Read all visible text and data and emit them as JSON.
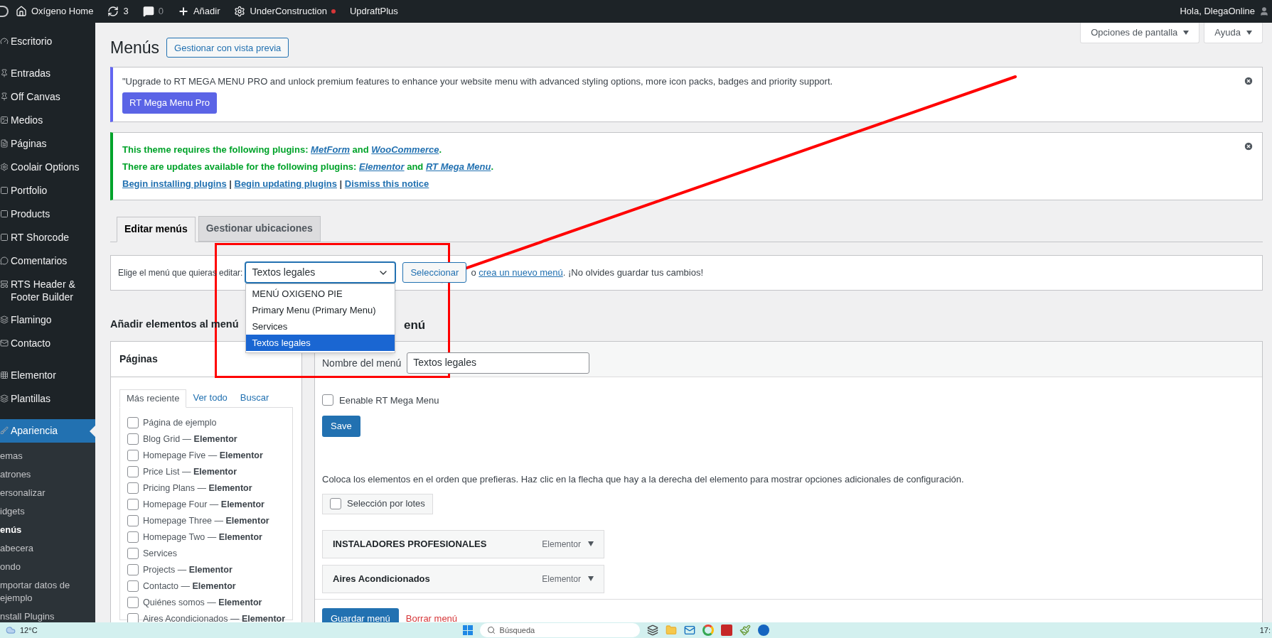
{
  "admin_bar": {
    "items": [
      {
        "kind": "home",
        "label": "Oxígeno Home"
      },
      {
        "kind": "updates",
        "label": "3"
      },
      {
        "kind": "comments",
        "label": "0"
      },
      {
        "kind": "new",
        "label": "Añadir"
      },
      {
        "kind": "construction",
        "label": "UnderConstruction"
      },
      {
        "kind": "plain",
        "label": "UpdraftPlus"
      }
    ],
    "greeting": "Hola, DlegaOnline"
  },
  "sidebar": {
    "items": [
      {
        "label": "Escritorio",
        "selected": false
      },
      {
        "label": "Entradas",
        "selected": false
      },
      {
        "label": "Off Canvas",
        "selected": false
      },
      {
        "label": "Medios",
        "selected": false
      },
      {
        "label": "Páginas",
        "selected": false
      },
      {
        "label": "Coolair Options",
        "selected": false
      },
      {
        "label": "Portfolio",
        "selected": false
      },
      {
        "label": "Products",
        "selected": false
      },
      {
        "label": "RT Shorcode",
        "selected": false
      },
      {
        "label": "Comentarios",
        "selected": false
      },
      {
        "label": "RTS Header & Footer Builder",
        "selected": false
      },
      {
        "label": "Flamingo",
        "selected": false
      },
      {
        "label": "Contacto",
        "selected": false
      },
      {
        "label": "Elementor",
        "selected": false
      },
      {
        "label": "Plantillas",
        "selected": false
      },
      {
        "label": "Apariencia",
        "selected": true
      }
    ],
    "submenu": [
      {
        "label": "emas",
        "selected": false
      },
      {
        "label": "atrones",
        "selected": false
      },
      {
        "label": "ersonalizar",
        "selected": false
      },
      {
        "label": "idgets",
        "selected": false
      },
      {
        "label": "enús",
        "selected": true
      },
      {
        "label": "abecera",
        "selected": false
      },
      {
        "label": "ondo",
        "selected": false
      },
      {
        "label": "mportar datos de ejemplo",
        "selected": false
      },
      {
        "label": "nstall Plugins",
        "selected": false
      }
    ]
  },
  "page": {
    "title": "Menús",
    "preview_button": "Gestionar con vista previa",
    "screen_options": "Opciones de pantalla",
    "help": "Ayuda"
  },
  "notices": [
    {
      "kind": "promo",
      "text": "\"Upgrade to RT MEGA MENU PRO and unlock premium features to enhance your website menu with advanced styling options, more icon packs, badges and priority support.",
      "button": "RT Mega Menu Pro"
    },
    {
      "kind": "plugins",
      "lines": [
        [
          {
            "text": "This theme requires the following plugins: "
          },
          {
            "link": "MetForm"
          },
          {
            "text": " and "
          },
          {
            "link": "WooCommerce"
          },
          {
            "text": "."
          }
        ],
        [
          {
            "text": "There are updates available for the following plugins: "
          },
          {
            "link": "Elementor"
          },
          {
            "text": " and "
          },
          {
            "link": "RT Mega Menu"
          },
          {
            "text": "."
          }
        ]
      ],
      "actions": [
        {
          "link": "Begin installing plugins"
        },
        {
          "text": " | "
        },
        {
          "link": "Begin updating plugins"
        },
        {
          "text": " | "
        },
        {
          "link": "Dismiss this notice"
        }
      ]
    }
  ],
  "tabs": [
    {
      "label": "Editar menús",
      "selected": true
    },
    {
      "label": "Gestionar ubicaciones",
      "selected": false
    }
  ],
  "menu_picker": {
    "label": "Elige el menú que quieras editar:",
    "value": "Textos legales",
    "expanded": true,
    "options": [
      {
        "label": "MENÚ OXIGENO PIE",
        "selected": false
      },
      {
        "label": "Primary Menu (Primary Menu)",
        "selected": false
      },
      {
        "label": "Services",
        "selected": false
      },
      {
        "label": "Textos legales",
        "selected": true
      }
    ],
    "button": "Seleccionar",
    "or": "o",
    "create_link": "crea un nuevo menú",
    "after": ". ¡No olvides guardar tus cambios!"
  },
  "add_items": {
    "heading": "Añadir elementos al menú",
    "panel_title": "Páginas",
    "tabs": [
      {
        "label": "Más reciente",
        "selected": true
      },
      {
        "label": "Ver todo",
        "selected": false
      },
      {
        "label": "Buscar",
        "selected": false
      }
    ],
    "pages": [
      {
        "title": "Página de ejemplo",
        "checked": false
      },
      {
        "title": "Blog Grid —",
        "builder": "Elementor",
        "checked": false
      },
      {
        "title": "Homepage Five —",
        "builder": "Elementor",
        "checked": false
      },
      {
        "title": "Price List —",
        "builder": "Elementor",
        "checked": false
      },
      {
        "title": "Pricing Plans —",
        "builder": "Elementor",
        "checked": false
      },
      {
        "title": "Homepage Four —",
        "builder": "Elementor",
        "checked": false
      },
      {
        "title": "Homepage Three —",
        "builder": "Elementor",
        "checked": false
      },
      {
        "title": "Homepage Two —",
        "builder": "Elementor",
        "checked": false
      },
      {
        "title": "Services",
        "checked": false
      },
      {
        "title": "Projects —",
        "builder": "Elementor",
        "checked": false
      },
      {
        "title": "Contacto —",
        "builder": "Elementor",
        "checked": false
      },
      {
        "title": "Quiénes somos —",
        "builder": "Elementor",
        "checked": false
      },
      {
        "title": "Aires Acondicionados —",
        "builder": "Elementor",
        "checked": false
      }
    ]
  },
  "structure": {
    "heading": "enú",
    "name_label": "Nombre del menú",
    "name_value": "Textos legales",
    "mega_menu": {
      "label": "Eenable RT Mega Menu",
      "checked": false
    },
    "save": "Save",
    "instructions": "Coloca los elementos en el orden que prefieras. Haz clic en la flecha que hay a la derecha del elemento para mostrar opciones adicionales de configuración.",
    "bulk": {
      "label": "Selección por lotes",
      "checked": false
    },
    "items": [
      {
        "title": "INSTALADORES PROFESIONALES",
        "type": "Elementor"
      },
      {
        "title": "Aires Acondicionados",
        "type": "Elementor"
      }
    ],
    "save_menu": "Guardar menú",
    "delete_menu": "Borrar menú"
  },
  "taskbar": {
    "weather": "12°C",
    "search_placeholder": "Búsqueda",
    "clock": "17:"
  }
}
